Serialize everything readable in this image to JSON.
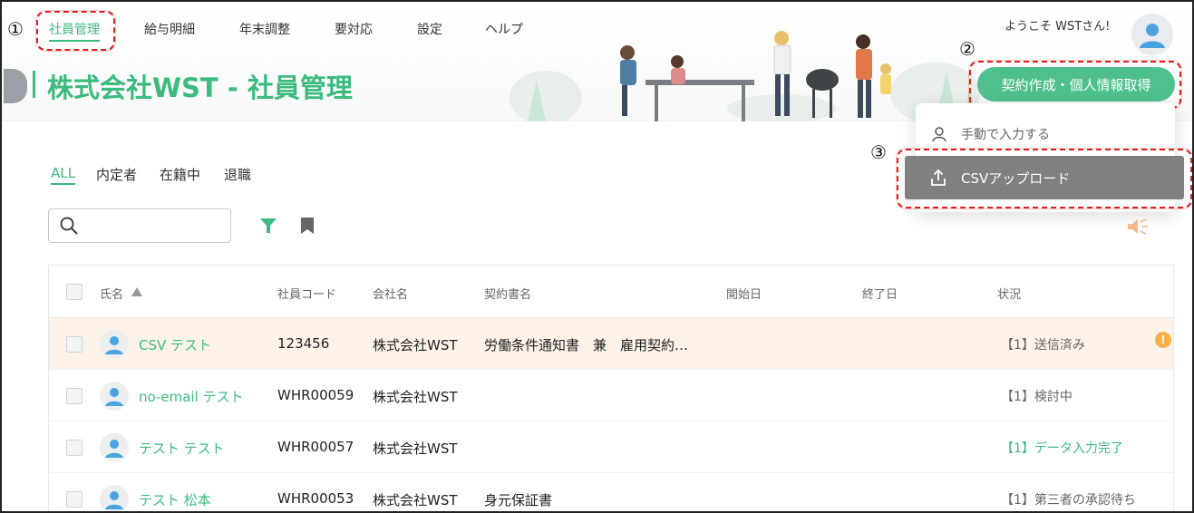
{
  "annotations": {
    "step1": "①",
    "step2": "②",
    "step3": "③"
  },
  "nav": {
    "items": [
      {
        "label": "社員管理",
        "active": true
      },
      {
        "label": "給与明細"
      },
      {
        "label": "年末調整"
      },
      {
        "label": "要対応"
      },
      {
        "label": "設定"
      },
      {
        "label": "ヘルプ"
      }
    ],
    "welcome": "ようこそ WSTさん!"
  },
  "page": {
    "title": "株式会社WST - 社員管理",
    "primary_button": "契約作成・個人情報取得"
  },
  "dropdown": {
    "manual_input": "手動で入力する",
    "csv_upload": "CSVアップロード"
  },
  "tabs": [
    {
      "label": "ALL",
      "active": true
    },
    {
      "label": "内定者"
    },
    {
      "label": "在籍中"
    },
    {
      "label": "退職"
    }
  ],
  "search": {
    "placeholder": ""
  },
  "table": {
    "headers": {
      "name": "氏名",
      "code": "社員コード",
      "company": "会社名",
      "contract": "契約書名",
      "start": "開始日",
      "end": "終了日",
      "status": "状況"
    },
    "rows": [
      {
        "name": "CSV テスト",
        "code": "123456",
        "company": "株式会社WST",
        "contract": "労働条件通知書　兼　雇用契約…",
        "status": "【1】送信済み",
        "warning": "!"
      },
      {
        "name": "no-email テスト",
        "code": "WHR00059",
        "company": "株式会社WST",
        "contract": "",
        "status": "【1】検討中"
      },
      {
        "name": "テスト テスト",
        "code": "WHR00057",
        "company": "株式会社WST",
        "contract": "",
        "status": "【1】データ入力完了"
      },
      {
        "name": "テスト 松本",
        "code": "WHR00053",
        "company": "株式会社WST",
        "contract": "身元保証書",
        "status": "【1】第三者の承認待ち"
      }
    ]
  },
  "colors": {
    "accent": "#3dbb7f",
    "button": "#4fc08d",
    "highlight_row": "#fdf3e9",
    "annotation": "#e02020",
    "csv_item": "#808080",
    "warning": "#f5b04a"
  },
  "icons": [
    "user-icon",
    "upload-icon",
    "search-icon",
    "filter-icon",
    "bookmark-icon",
    "speaker-icon",
    "avatar-icon",
    "sort-ascending-icon",
    "warning-icon"
  ]
}
